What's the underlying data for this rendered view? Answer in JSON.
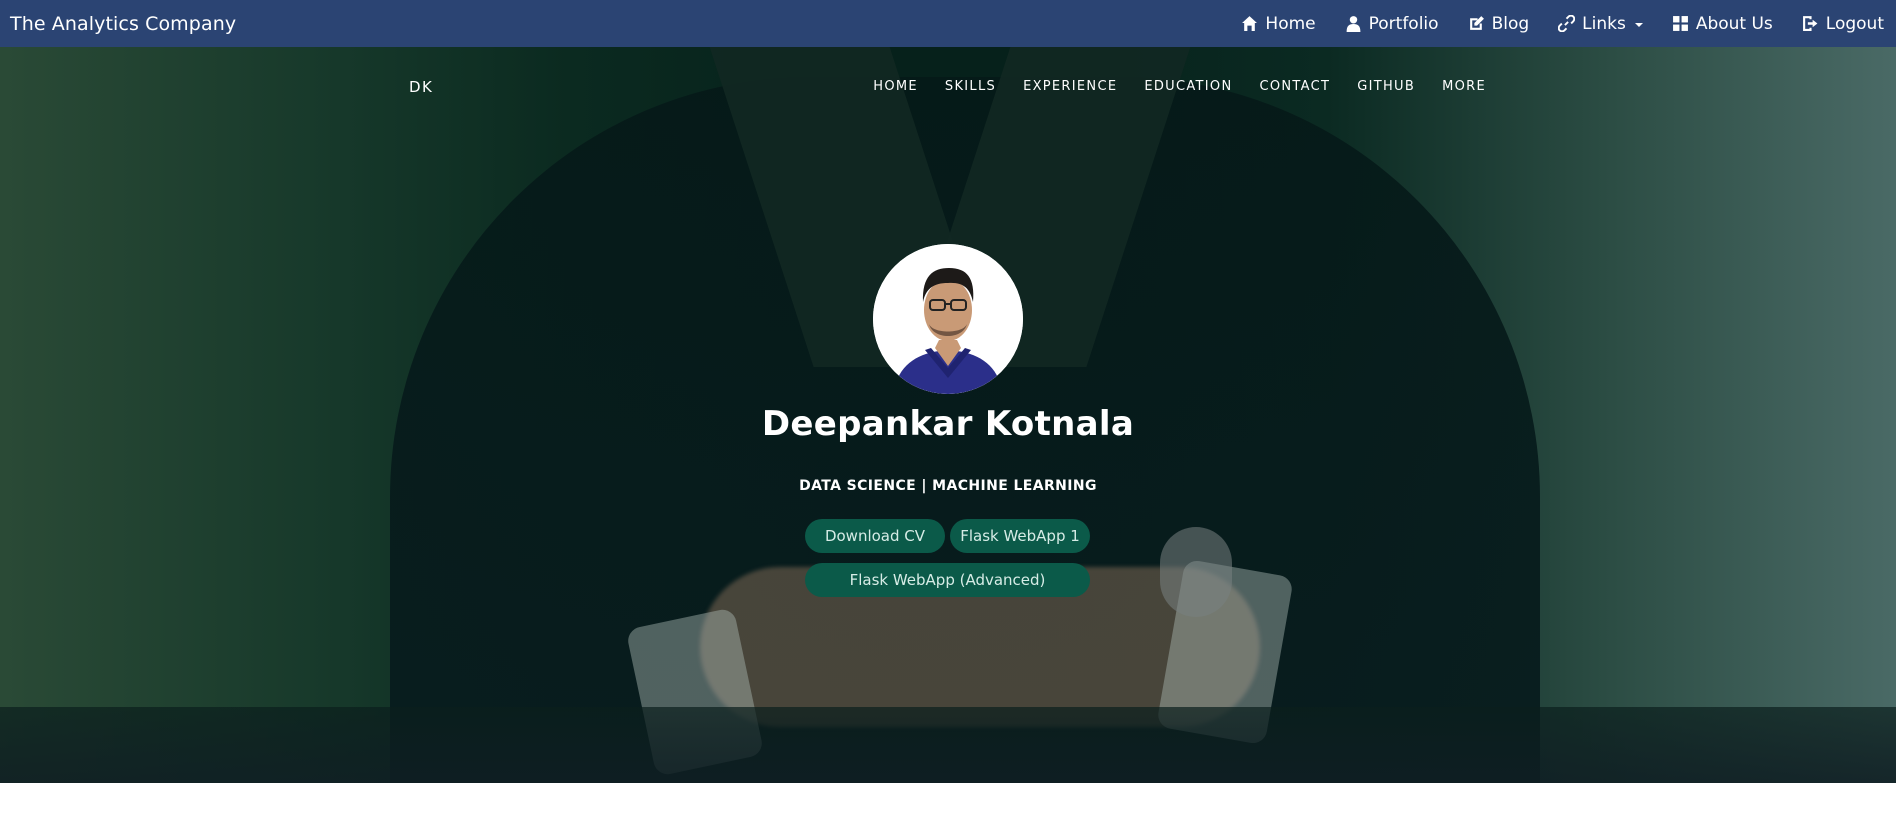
{
  "topbar": {
    "brand": "The Analytics Company",
    "items": [
      {
        "label": "Home",
        "icon": "home-icon"
      },
      {
        "label": "Portfolio",
        "icon": "user-icon"
      },
      {
        "label": "Blog",
        "icon": "edit-icon"
      },
      {
        "label": "Links",
        "icon": "link-icon",
        "dropdown": true
      },
      {
        "label": "About Us",
        "icon": "grid-icon"
      },
      {
        "label": "Logout",
        "icon": "logout-icon"
      }
    ],
    "background": "#2b4473"
  },
  "hero": {
    "brand": "DK",
    "nav": [
      "HOME",
      "SKILLS",
      "EXPERIENCE",
      "EDUCATION",
      "CONTACT",
      "GITHUB",
      "MORE"
    ],
    "name": "Deepankar Kotnala",
    "subtitle": "DATA SCIENCE | MACHINE LEARNING",
    "buttons": [
      "Download CV",
      "Flask WebApp 1",
      "Flask WebApp (Advanced)"
    ],
    "button_color": "#0b5a49"
  }
}
